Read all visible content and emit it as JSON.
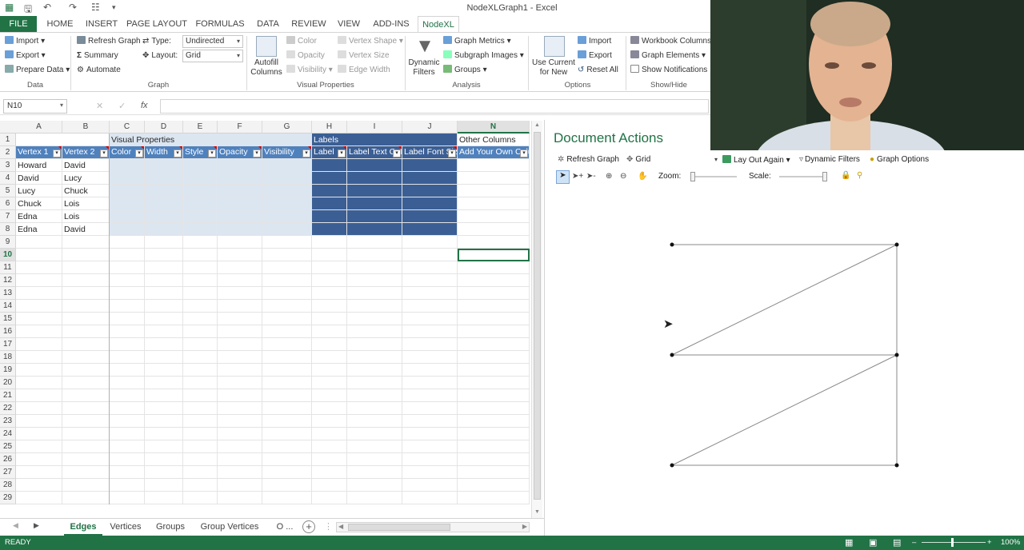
{
  "window": {
    "title": "NodeXLGraph1 - Excel"
  },
  "ribbon_tabs": [
    {
      "label": "FILE"
    },
    {
      "label": "HOME"
    },
    {
      "label": "INSERT"
    },
    {
      "label": "PAGE LAYOUT"
    },
    {
      "label": "FORMULAS"
    },
    {
      "label": "DATA"
    },
    {
      "label": "REVIEW"
    },
    {
      "label": "VIEW"
    },
    {
      "label": "ADD-INS"
    },
    {
      "label": "NodeXL"
    }
  ],
  "ribbon": {
    "data": {
      "import": "Import",
      "export": "Export",
      "prepare": "Prepare Data",
      "group": "Data"
    },
    "graph": {
      "refresh": "Refresh Graph",
      "summary": "Summary",
      "automate": "Automate",
      "type_label": "Type:",
      "type_value": "Undirected",
      "layout_label": "Layout:",
      "layout_value": "Grid",
      "group": "Graph"
    },
    "visual": {
      "autofill": "Autofill Columns",
      "color": "Color",
      "opacity": "Opacity",
      "visibility": "Visibility",
      "vertex_shape": "Vertex Shape",
      "vertex_size": "Vertex Size",
      "edge_width": "Edge Width",
      "group": "Visual Properties"
    },
    "analysis": {
      "dynamic_filters": "Dynamic Filters",
      "graph_metrics": "Graph Metrics",
      "subgraph_images": "Subgraph Images",
      "groups": "Groups",
      "group": "Analysis"
    },
    "options": {
      "use_current": "Use Current for New",
      "import": "Import",
      "export": "Export",
      "reset_all": "Reset All",
      "group": "Options"
    },
    "showhide": {
      "workbook_columns": "Workbook Columns",
      "graph_elements": "Graph Elements",
      "show_notifications": "Show Notifications",
      "group": "Show/Hide"
    }
  },
  "formula_bar": {
    "name_box": "N10",
    "cancel": "✕",
    "enter": "✓",
    "fx": "fx",
    "formula": ""
  },
  "columns": [
    "A",
    "B",
    "C",
    "D",
    "E",
    "F",
    "G",
    "H",
    "I",
    "J",
    "N"
  ],
  "selected_column": "N",
  "rows": [
    "1",
    "2",
    "3",
    "4",
    "5",
    "6",
    "7",
    "8",
    "9",
    "10",
    "11",
    "12",
    "13",
    "14",
    "15",
    "16",
    "17",
    "18",
    "19",
    "20",
    "21",
    "22",
    "23",
    "24",
    "25",
    "26",
    "27",
    "28",
    "29"
  ],
  "selected_row": "10",
  "group_headers": {
    "visual": "Visual Properties",
    "labels": "Labels",
    "other": "Other Columns"
  },
  "table_headers": [
    "Vertex 1",
    "Vertex 2",
    "Color",
    "Width",
    "Style",
    "Opacity",
    "Visibility",
    "Label",
    "Label Text Color",
    "Label Font Size",
    "Add Your Own Columns Here"
  ],
  "edges": [
    [
      "Howard",
      "David"
    ],
    [
      "David",
      "Lucy"
    ],
    [
      "Lucy",
      "Chuck"
    ],
    [
      "Chuck",
      "Lois"
    ],
    [
      "Edna",
      "Lois"
    ],
    [
      "Edna",
      "David"
    ]
  ],
  "sheet_tabs": [
    {
      "label": "Edges"
    },
    {
      "label": "Vertices"
    },
    {
      "label": "Groups"
    },
    {
      "label": "Group Vertices"
    },
    {
      "label": "O ..."
    }
  ],
  "active_sheet": "Edges",
  "status": {
    "ready": "READY",
    "zoom": "100%"
  },
  "panel": {
    "title": "Document Actions",
    "refresh": "Refresh Graph",
    "layout": "Grid",
    "lay_out_again": "Lay Out Again",
    "dynamic_filters": "Dynamic Filters",
    "graph_options": "Graph Options",
    "zoom_label": "Zoom:",
    "scale_label": "Scale:",
    "zoom_level": 0.0,
    "scale_level": 1.0
  },
  "graph": {
    "vertices": [
      {
        "x": 0,
        "y": 0
      },
      {
        "x": 1,
        "y": 0
      },
      {
        "x": 0,
        "y": 1
      },
      {
        "x": 1,
        "y": 1
      },
      {
        "x": 0,
        "y": 2
      },
      {
        "x": 1,
        "y": 2
      }
    ],
    "edges": [
      [
        0,
        1
      ],
      [
        1,
        2
      ],
      [
        2,
        3
      ],
      [
        3,
        4
      ],
      [
        4,
        5
      ],
      [
        5,
        1
      ]
    ]
  },
  "colors": {
    "excel_green": "#217346",
    "header_blue": "#4f81bd",
    "label_blue": "#3b5f95",
    "band_light": "#dce6f1"
  }
}
